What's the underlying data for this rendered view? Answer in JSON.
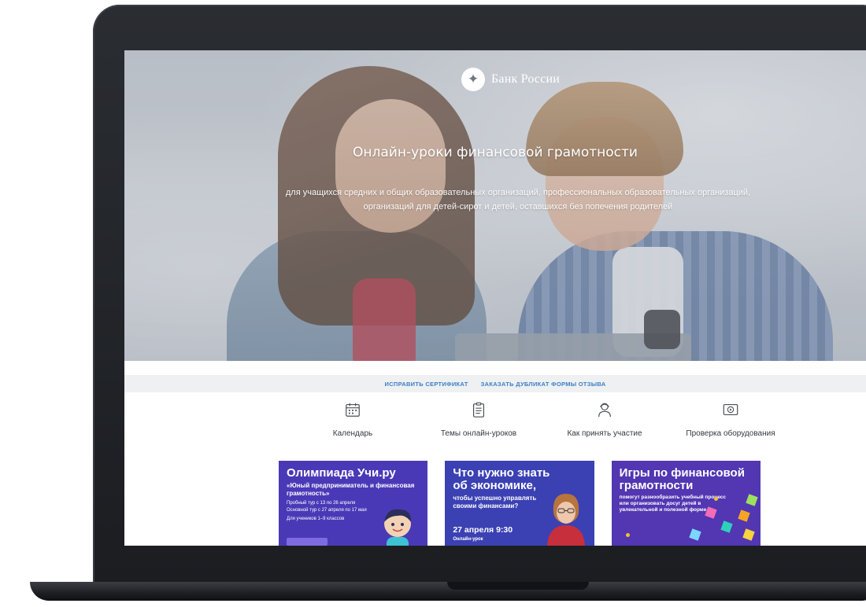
{
  "hero": {
    "brand": "Банк России",
    "title": "Онлайн-уроки финансовой грамотности",
    "subtitle": "для учащихся средних и общих образовательных организаций, профессиональных образовательных организаций, организаций для детей-сирот и детей, оставшихся без попечения родителей"
  },
  "links": {
    "fix_certificate": "ИСПРАВИТЬ СЕРТИФИКАТ",
    "order_duplicate": "ЗАКАЗАТЬ ДУБЛИКАТ ФОРМЫ ОТЗЫВА"
  },
  "features": [
    {
      "icon": "calendar-icon",
      "label": "Календарь"
    },
    {
      "icon": "clipboard-icon",
      "label": "Темы онлайн-уроков"
    },
    {
      "icon": "person-icon",
      "label": "Как принять участие"
    },
    {
      "icon": "play-icon",
      "label": "Проверка оборудования"
    }
  ],
  "cards": [
    {
      "title": "Олимпиада Учи.ру",
      "subtitle": "«Юный предприниматель и финансовая грамотность»",
      "line1": "Пробный тур с 13 по 26 апреля",
      "line2": "Основной тур с 27 апреля по 17 мая",
      "line3": "Для учеников 1–9 классов",
      "bg": "#4a39b7"
    },
    {
      "title": "Что нужно знать об экономике,",
      "subtitle": "чтобы успешно управлять своими финансами?",
      "date": "27 апреля 9:30",
      "tag": "Онлайн-урок",
      "bg": "#3b41b3"
    },
    {
      "title": "Игры по финансовой грамотности",
      "subtitle": "помогут разнообразить учебный процесс или организовать досуг детей в увлекательной и полезной форме",
      "bg": "#5236b2"
    }
  ],
  "colors": {
    "link": "#3a7fc4",
    "card_purple": "#4a39b7",
    "laptop": "#1f2126"
  }
}
